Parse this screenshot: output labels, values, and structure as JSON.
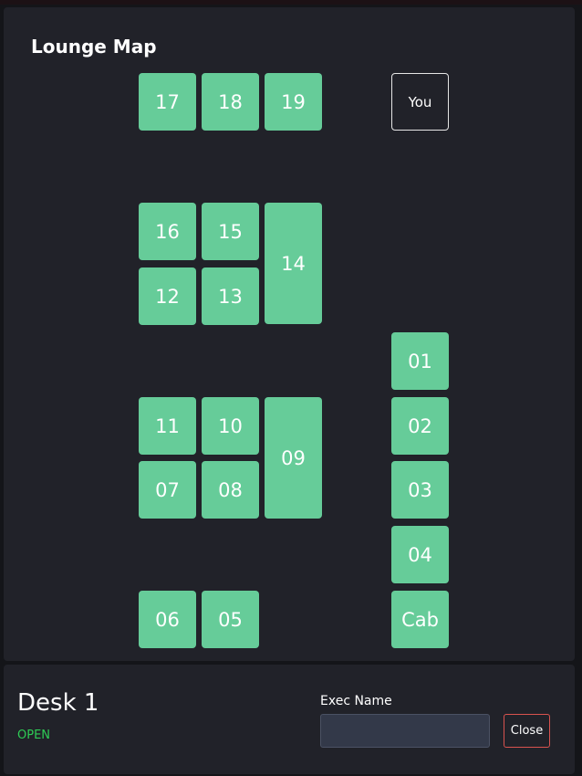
{
  "map": {
    "title": "Lounge Map",
    "desks": [
      {
        "id": "17",
        "label": "17"
      },
      {
        "id": "18",
        "label": "18"
      },
      {
        "id": "19",
        "label": "19"
      },
      {
        "id": "you",
        "label": "You"
      },
      {
        "id": "16",
        "label": "16"
      },
      {
        "id": "15",
        "label": "15"
      },
      {
        "id": "14",
        "label": "14"
      },
      {
        "id": "12",
        "label": "12"
      },
      {
        "id": "13",
        "label": "13"
      },
      {
        "id": "01",
        "label": "01"
      },
      {
        "id": "11",
        "label": "11"
      },
      {
        "id": "10",
        "label": "10"
      },
      {
        "id": "09",
        "label": "09"
      },
      {
        "id": "02",
        "label": "02"
      },
      {
        "id": "07",
        "label": "07"
      },
      {
        "id": "08",
        "label": "08"
      },
      {
        "id": "03",
        "label": "03"
      },
      {
        "id": "04",
        "label": "04"
      },
      {
        "id": "06",
        "label": "06"
      },
      {
        "id": "05",
        "label": "05"
      },
      {
        "id": "cab",
        "label": "Cab"
      }
    ]
  },
  "detail": {
    "desk_name": "Desk 1",
    "status": "OPEN",
    "exec_label": "Exec Name",
    "exec_value": "",
    "exec_placeholder": "",
    "close_label": "Close"
  },
  "colors": {
    "desk_available": "#66cc99",
    "status_open": "#2ecc55",
    "close_border": "#d9534f",
    "panel_bg": "#212229"
  }
}
